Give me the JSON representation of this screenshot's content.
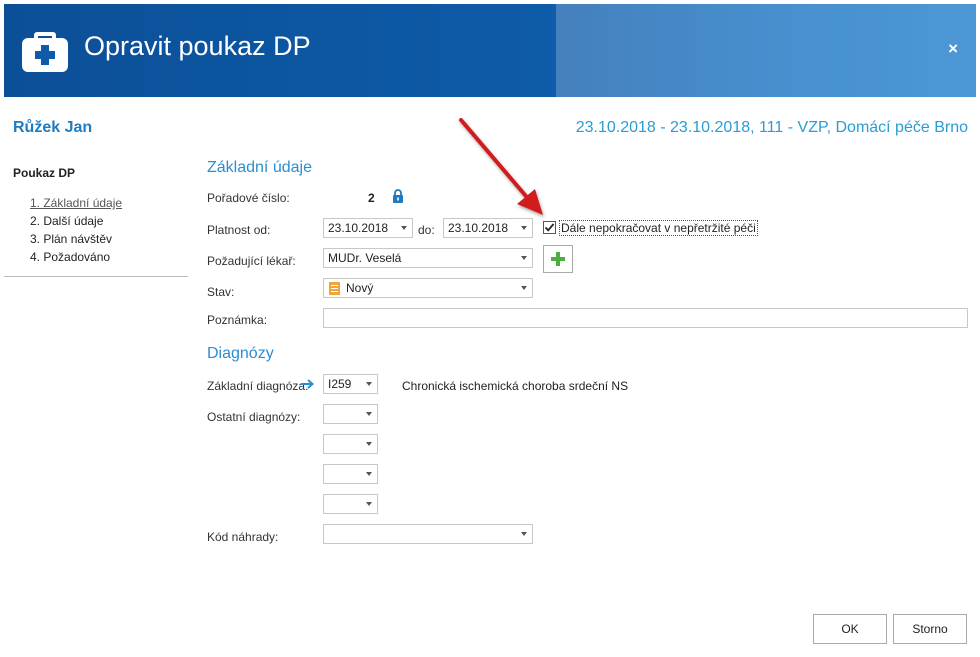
{
  "window": {
    "title": "Opravit poukaz DP",
    "close_label": "×",
    "accent_color": "#0e5ba8"
  },
  "header": {
    "patient_name": "Růžek Jan",
    "episode": "23.10.2018 - 23.10.2018, 111 - VZP, Domácí péče Brno"
  },
  "sidebar": {
    "title": "Poukaz DP",
    "items": [
      {
        "label": "1. Základní údaje",
        "active": true
      },
      {
        "label": "2. Další údaje"
      },
      {
        "label": "3. Plán návštěv"
      },
      {
        "label": "4. Požadováno"
      }
    ]
  },
  "basic": {
    "section_title": "Základní údaje",
    "order_label": "Pořadové číslo:",
    "order_value": "2",
    "validity_label": "Platnost od:",
    "valid_from": "23.10.2018",
    "to_label": "do:",
    "valid_to": "23.10.2018",
    "continue_checkbox_label": "Dále nepokračovat v nepřetržité péči",
    "continue_checked": true,
    "doctor_label": "Požadující lékař:",
    "doctor_value": "MUDr. Veselá",
    "state_label": "Stav:",
    "state_value": "Nový",
    "note_label": "Poznámka:",
    "note_value": ""
  },
  "diagnoses": {
    "section_title": "Diagnózy",
    "main_label": "Základní diagnóza:",
    "main_code": "I259",
    "main_description": "Chronická ischemická choroba srdeční NS",
    "other_label": "Ostatní diagnózy:",
    "others": [
      "",
      "",
      "",
      ""
    ],
    "replacement_label": "Kód náhrady:",
    "replacement_value": ""
  },
  "buttons": {
    "ok": "OK",
    "cancel": "Storno"
  }
}
